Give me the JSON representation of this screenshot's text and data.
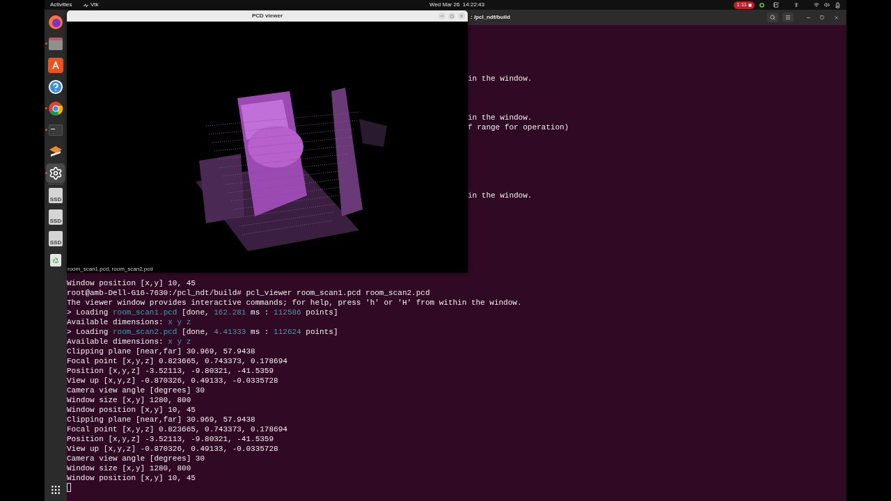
{
  "top_bar": {
    "activities": "Activities",
    "app_name": "Vtk",
    "clock": "Wed Mar 26  14:22:43",
    "recording": {
      "time": "1:11",
      "on": true
    }
  },
  "dock": {
    "items": [
      {
        "kind": "firefox",
        "running": false,
        "selected": false
      },
      {
        "kind": "files",
        "running": true,
        "selected": false
      },
      {
        "kind": "store",
        "running": false,
        "selected": false
      },
      {
        "kind": "help",
        "running": false,
        "selected": false
      },
      {
        "kind": "chrome",
        "running": true,
        "selected": false
      },
      {
        "kind": "terminal",
        "running": true,
        "selected": false
      },
      {
        "kind": "editor",
        "running": false,
        "selected": false
      },
      {
        "kind": "settings",
        "running": true,
        "selected": true
      },
      {
        "kind": "drive",
        "label": "SSD",
        "running": false,
        "selected": false
      },
      {
        "kind": "drive",
        "label": "SSD",
        "running": false,
        "selected": false
      },
      {
        "kind": "drive",
        "label": "SSD",
        "running": false,
        "selected": false
      },
      {
        "kind": "trash",
        "running": false,
        "selected": false
      }
    ]
  },
  "terminal": {
    "title": ": /pcl_ndt/build",
    "fragments": [
      "in the window.",
      "in the window.",
      "f range for operation)",
      "in the window."
    ],
    "lines": [
      [
        {
          "text": "Window position [x,y] 10, 45",
          "kind": "plain"
        }
      ],
      [
        {
          "text": "root@amb-Dell-G16-7630:/pcl_ndt/build# pcl_viewer room_scan1.pcd room_scan2.pcd",
          "kind": "plain"
        }
      ],
      [
        {
          "text": "The viewer window provides interactive commands; for help, press 'h' or 'H' from within the window.",
          "kind": "plain"
        }
      ],
      [
        {
          "text": "> Loading ",
          "kind": "plain"
        },
        {
          "text": "room_scan1.pcd",
          "kind": "highlight"
        },
        {
          "text": " [done, ",
          "kind": "plain"
        },
        {
          "text": "162.281",
          "kind": "highlight"
        },
        {
          "text": " ms : ",
          "kind": "plain"
        },
        {
          "text": "112586",
          "kind": "highlight"
        },
        {
          "text": " points]",
          "kind": "plain"
        }
      ],
      [
        {
          "text": "Available dimensions: ",
          "kind": "plain"
        },
        {
          "text": "x y z",
          "kind": "highlight"
        }
      ],
      [
        {
          "text": "> Loading ",
          "kind": "plain"
        },
        {
          "text": "room_scan2.pcd",
          "kind": "highlight"
        },
        {
          "text": " [done, ",
          "kind": "plain"
        },
        {
          "text": "4.41333",
          "kind": "highlight"
        },
        {
          "text": " ms : ",
          "kind": "plain"
        },
        {
          "text": "112624",
          "kind": "highlight"
        },
        {
          "text": " points]",
          "kind": "plain"
        }
      ],
      [
        {
          "text": "Available dimensions: ",
          "kind": "plain"
        },
        {
          "text": "x y z",
          "kind": "highlight"
        }
      ],
      [
        {
          "text": "Clipping plane [near,far] 30.969, 57.9438",
          "kind": "plain"
        }
      ],
      [
        {
          "text": "Focal point [x,y,z] 0.823665, 0.743373, 0.178694",
          "kind": "plain"
        }
      ],
      [
        {
          "text": "Position [x,y,z] -3.52113, -9.80321, -41.5359",
          "kind": "plain"
        }
      ],
      [
        {
          "text": "View up [x,y,z] -0.870326, 0.49133, -0.0335728",
          "kind": "plain"
        }
      ],
      [
        {
          "text": "Camera view angle [degrees] 30",
          "kind": "plain"
        }
      ],
      [
        {
          "text": "Window size [x,y] 1280, 800",
          "kind": "plain"
        }
      ],
      [
        {
          "text": "Window position [x,y] 10, 45",
          "kind": "plain"
        }
      ],
      [
        {
          "text": "Clipping plane [near,far] 30.969, 57.9438",
          "kind": "plain"
        }
      ],
      [
        {
          "text": "Focal point [x,y,z] 0.823665, 0.743373, 0.178694",
          "kind": "plain"
        }
      ],
      [
        {
          "text": "Position [x,y,z] -3.52113, -9.80321, -41.5359",
          "kind": "plain"
        }
      ],
      [
        {
          "text": "View up [x,y,z] -0.870326, 0.49133, -0.0335728",
          "kind": "plain"
        }
      ],
      [
        {
          "text": "Camera view angle [degrees] 30",
          "kind": "plain"
        }
      ],
      [
        {
          "text": "Window size [x,y] 1280, 800",
          "kind": "plain"
        }
      ],
      [
        {
          "text": "Window position [x,y] 10, 45",
          "kind": "plain"
        }
      ]
    ]
  },
  "viewer": {
    "title": "PCD viewer",
    "caption": "room_scan1.pcd, room_scan2.pcd"
  }
}
